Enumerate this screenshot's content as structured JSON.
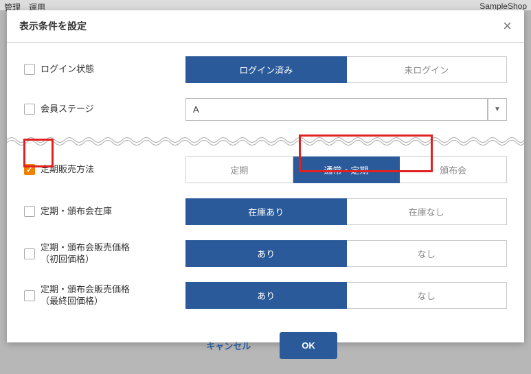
{
  "bg": {
    "left": "管理　運用",
    "right": "SampleShop"
  },
  "modal": {
    "title": "表示条件を設定",
    "rows": {
      "login": {
        "label": "ログイン状態",
        "opt1": "ログイン済み",
        "opt2": "未ログイン"
      },
      "memberStage": {
        "label": "会員ステージ",
        "value": "A"
      },
      "salesMethod": {
        "label": "定期販売方法",
        "opt1": "定期",
        "opt2": "通常・定期",
        "opt3": "頒布会"
      },
      "stock": {
        "label": "定期・頒布会在庫",
        "opt1": "在庫あり",
        "opt2": "在庫なし"
      },
      "firstPrice": {
        "label": "定期・頒布会販売価格\n（初回価格）",
        "opt1": "あり",
        "opt2": "なし"
      },
      "lastPrice": {
        "label": "定期・頒布会販売価格\n（最終回価格）",
        "opt1": "あり",
        "opt2": "なし"
      }
    },
    "footer": {
      "cancel": "キャンセル",
      "ok": "OK"
    }
  }
}
